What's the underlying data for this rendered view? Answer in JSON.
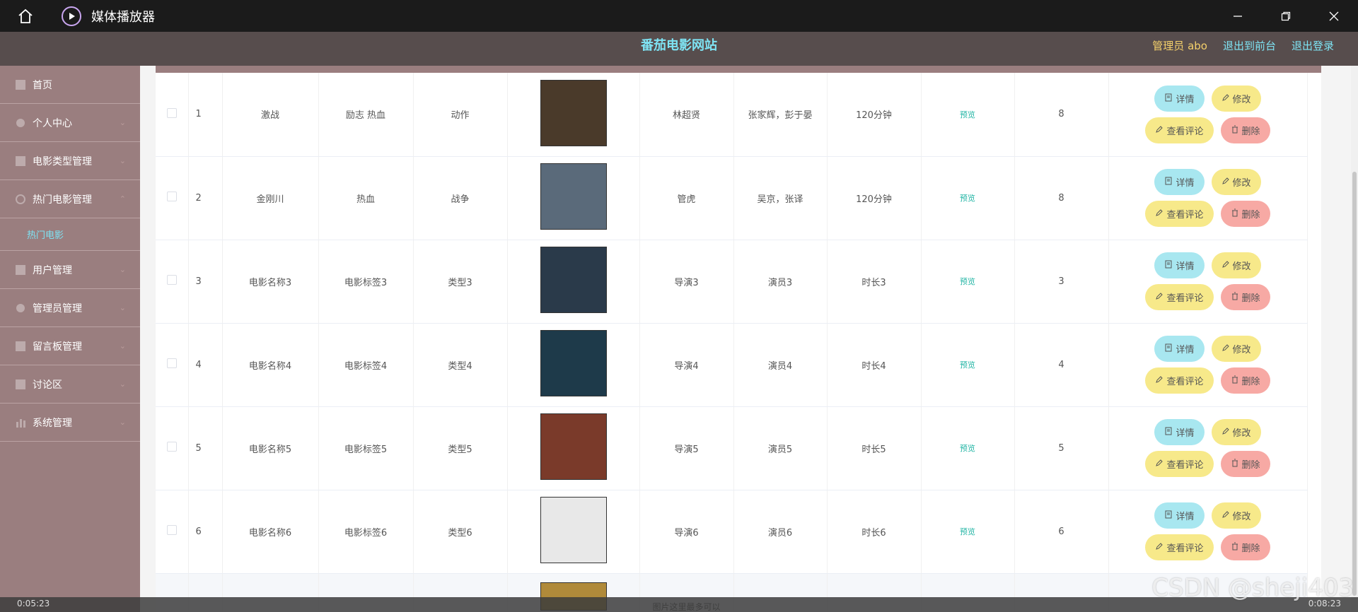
{
  "player": {
    "title": "媒体播放器",
    "time_left": "0:05:23",
    "time_right": "0:08:23"
  },
  "site": {
    "title": "番茄电影网站",
    "admin": "管理员 abo",
    "back_front": "退出到前台",
    "logout": "退出登录"
  },
  "sidebar": {
    "items": [
      {
        "label": "首页",
        "icon": "home-icon"
      },
      {
        "label": "个人中心",
        "icon": "user-icon"
      },
      {
        "label": "电影类型管理",
        "icon": "film-icon"
      },
      {
        "label": "热门电影管理",
        "icon": "fire-icon"
      },
      {
        "label": "用户管理",
        "icon": "users-icon"
      },
      {
        "label": "管理员管理",
        "icon": "admin-icon"
      },
      {
        "label": "留言板管理",
        "icon": "message-icon"
      },
      {
        "label": "讨论区",
        "icon": "forum-icon"
      },
      {
        "label": "系统管理",
        "icon": "chart-icon"
      }
    ],
    "active_sub": "热门电影"
  },
  "table": {
    "preview_text": "预览",
    "btn_detail": "详情",
    "btn_edit": "修改",
    "btn_comment": "查看评论",
    "btn_delete": "删除",
    "rows": [
      {
        "idx": "1",
        "name": "激战",
        "tags": "励志 热血",
        "type": "动作",
        "director": "林超贤",
        "actors": "张家辉，彭于晏",
        "duration": "120分钟",
        "score": "8",
        "poster_color": "#4a3a2a"
      },
      {
        "idx": "2",
        "name": "金刚川",
        "tags": "热血",
        "type": "战争",
        "director": "管虎",
        "actors": "吴京，张译",
        "duration": "120分钟",
        "score": "8",
        "poster_color": "#5a6a7a"
      },
      {
        "idx": "3",
        "name": "电影名称3",
        "tags": "电影标签3",
        "type": "类型3",
        "director": "导演3",
        "actors": "演员3",
        "duration": "时长3",
        "score": "3",
        "poster_color": "#2a3a4a"
      },
      {
        "idx": "4",
        "name": "电影名称4",
        "tags": "电影标签4",
        "type": "类型4",
        "director": "导演4",
        "actors": "演员4",
        "duration": "时长4",
        "score": "4",
        "poster_color": "#1e3a4a"
      },
      {
        "idx": "5",
        "name": "电影名称5",
        "tags": "电影标签5",
        "type": "类型5",
        "director": "导演5",
        "actors": "演员5",
        "duration": "时长5",
        "score": "5",
        "poster_color": "#7a3a2a"
      },
      {
        "idx": "6",
        "name": "电影名称6",
        "tags": "电影标签6",
        "type": "类型6",
        "director": "导演6",
        "actors": "演员6",
        "duration": "时长6",
        "score": "6",
        "poster_color": "#e8e8e8"
      }
    ],
    "partial_note": "图片这里最多可以"
  },
  "watermark": "CSDN @sheji403"
}
